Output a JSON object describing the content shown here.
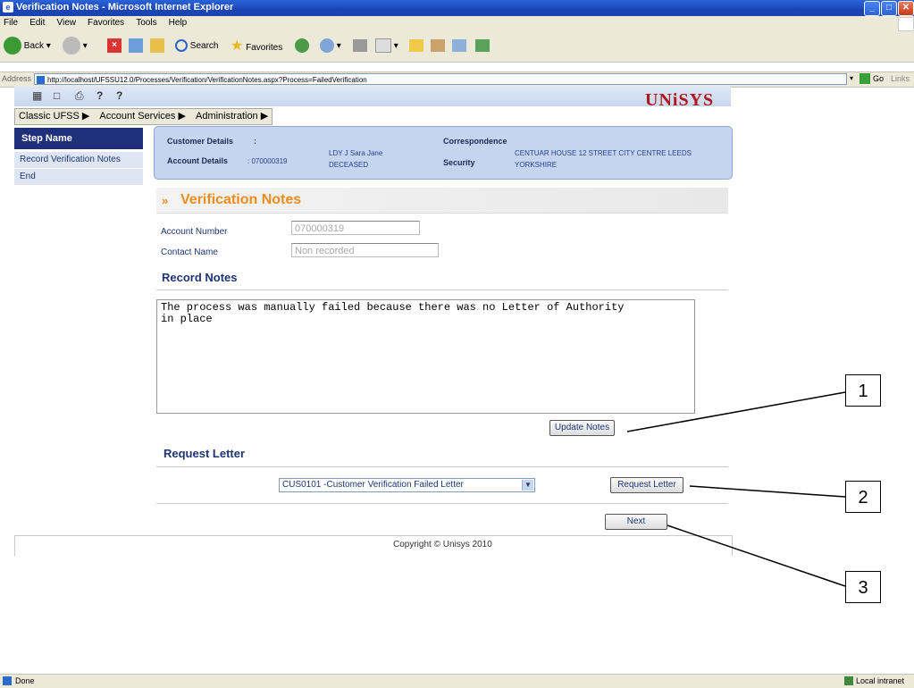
{
  "window": {
    "title": "Verification Notes - Microsoft Internet Explorer"
  },
  "menubar": [
    "File",
    "Edit",
    "View",
    "Favorites",
    "Tools",
    "Help"
  ],
  "toolbar": {
    "back": "Back",
    "search": "Search",
    "favorites": "Favorites"
  },
  "address": {
    "label": "Address",
    "url": "http://localhost/UFSSU12.0/Processes/Verification/VerificationNotes.aspx?Process=FailedVerification",
    "go": "Go",
    "links": "Links"
  },
  "brand": "UNiSYS",
  "navmenu": [
    "Classic UFSS ▶",
    "Account Services ▶",
    "Administration ▶"
  ],
  "steps": {
    "header": "Step Name",
    "items": [
      "Record Verification Notes",
      "End"
    ]
  },
  "customer": {
    "details_label": "Customer Details",
    "details_colon": ":",
    "account_label": "Account Details",
    "account_value": ": 070000319",
    "name_value": "LDY J Sara Jane",
    "status_value": "DECEASED",
    "correspondence_label": "Correspondence",
    "address_value": "CENTUAR HOUSE 12 STREET CITY CENTRE LEEDS",
    "address_value2": "YORKSHIRE",
    "security_label": "Security"
  },
  "form": {
    "title": "Verification Notes",
    "account_label": "Account Number",
    "account_value": "070000319",
    "contact_label": "Contact Name",
    "contact_value": "Non recorded",
    "record_notes_head": "Record Notes",
    "notes_text": "The process was manually failed because there was no Letter of Authority\nin place",
    "update_button": "Update Notes",
    "request_letter_head": "Request Letter",
    "letter_selected": "CUS0101 -Customer Verification Failed Letter",
    "request_button": "Request Letter",
    "next_button": "Next"
  },
  "footer": {
    "copyright": "Copyright © Unisys 2010"
  },
  "callouts": [
    "1",
    "2",
    "3"
  ],
  "status": {
    "left": "Done",
    "right": "Local intranet"
  }
}
